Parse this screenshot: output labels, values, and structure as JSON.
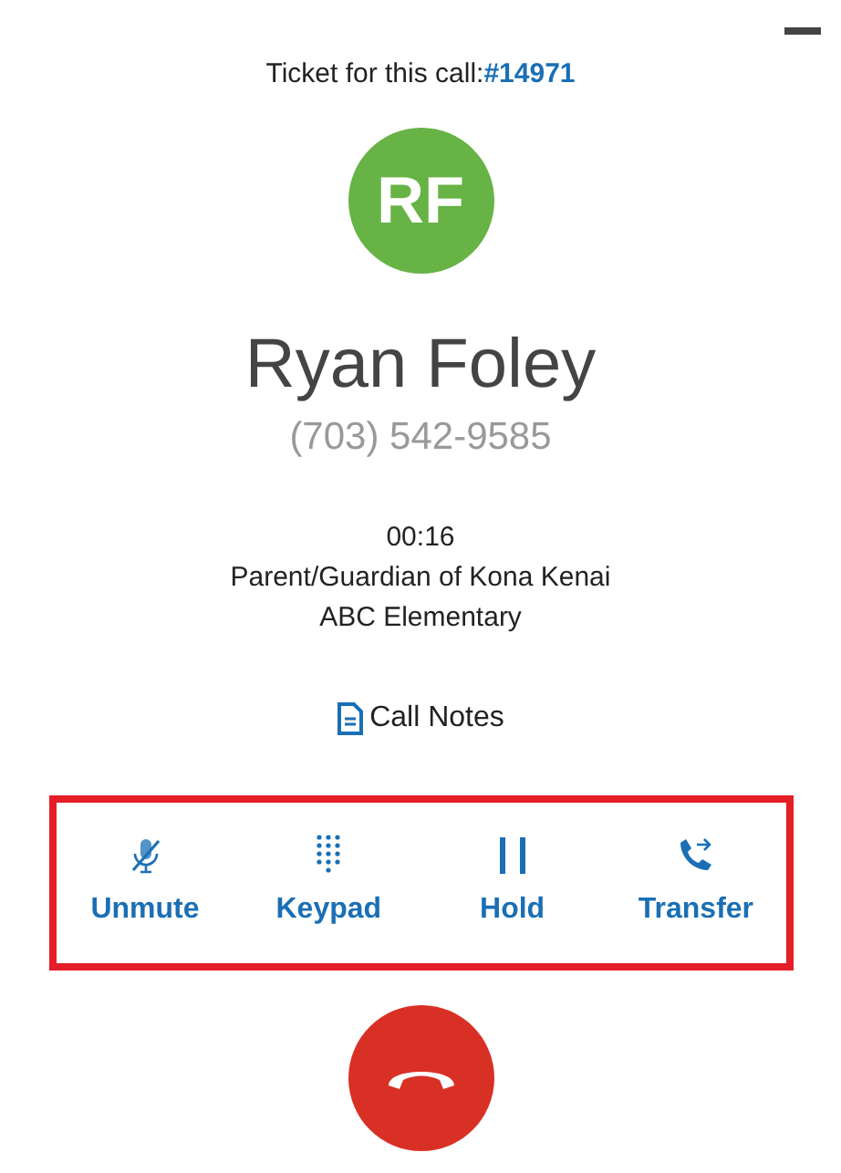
{
  "ticket": {
    "label": "Ticket for this call:",
    "number": "#14971"
  },
  "caller": {
    "initials": "RF",
    "name": "Ryan Foley",
    "phone": "(703) 542-9585",
    "duration": "00:16",
    "relation": "Parent/Guardian of Kona Kenai",
    "school": "ABC Elementary"
  },
  "call_notes": "Call Notes",
  "controls": [
    {
      "kind": "mute",
      "label": "Unmute",
      "muted": true
    },
    {
      "kind": "keypad",
      "label": "Keypad"
    },
    {
      "kind": "hold",
      "label": "Hold"
    },
    {
      "kind": "transfer",
      "label": "Transfer"
    }
  ]
}
